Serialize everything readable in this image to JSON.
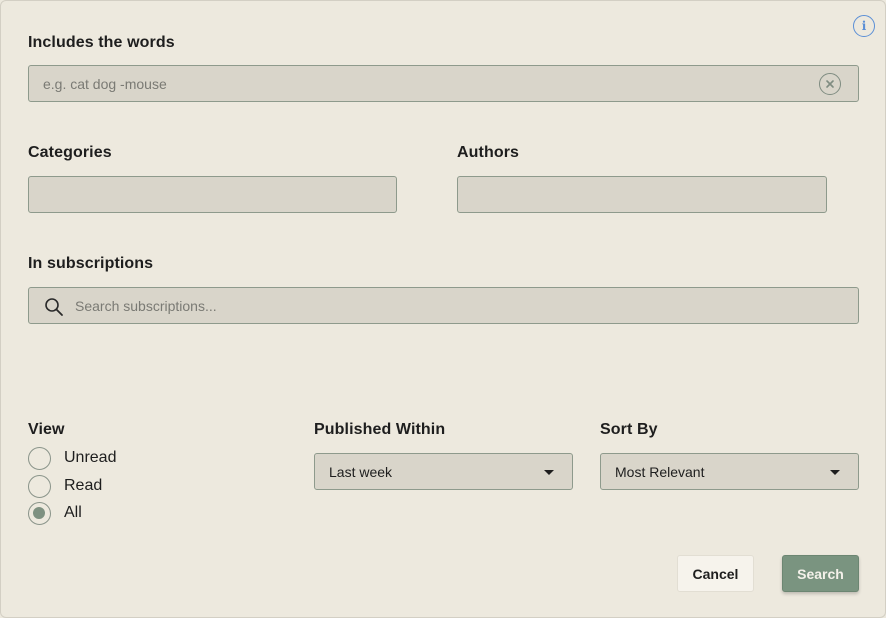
{
  "includes": {
    "label": "Includes the words",
    "placeholder": "e.g. cat dog -mouse"
  },
  "categories": {
    "label": "Categories"
  },
  "authors": {
    "label": "Authors"
  },
  "subscriptions": {
    "label": "In subscriptions",
    "placeholder": "Search subscriptions..."
  },
  "view": {
    "label": "View",
    "options": [
      {
        "label": "Unread",
        "checked": false
      },
      {
        "label": "Read",
        "checked": false
      },
      {
        "label": "All",
        "checked": true
      }
    ]
  },
  "published": {
    "label": "Published Within",
    "value": "Last week"
  },
  "sort": {
    "label": "Sort By",
    "value": "Most Relevant"
  },
  "buttons": {
    "cancel": "Cancel",
    "search": "Search"
  },
  "icons": {
    "info": "info-icon",
    "clear": "clear-icon",
    "search": "search-icon",
    "dropdown": "caret-down-icon"
  },
  "colors": {
    "background": "#ede9de",
    "field": "#d9d5ca",
    "accent": "#7a9480",
    "info": "#5b8fd6"
  }
}
